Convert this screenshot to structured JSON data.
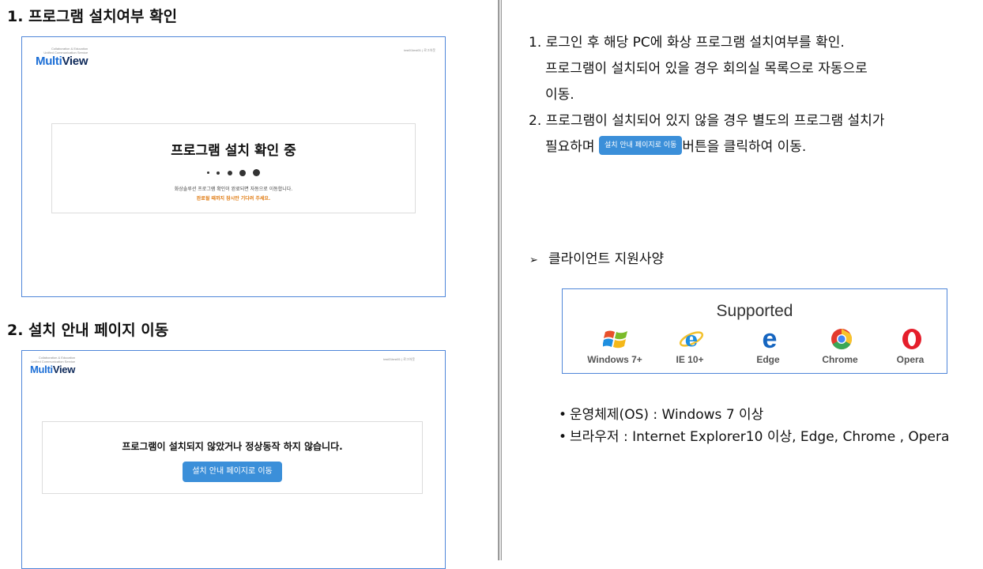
{
  "left": {
    "section1": {
      "title": "1. 프로그램 설치여부 확인",
      "shot": {
        "logo_tagline_1": "Collaboration & Education",
        "logo_tagline_2": "Unified Communication Service",
        "logo_multi": "Multi",
        "logo_view": "View",
        "user_links": "test01test01 | 로그아웃",
        "card_title": "프로그램 설치 확인 중",
        "card_message": "화상솔루션 프로그램 확인이 완료되면 자동으로 이동합니다.",
        "card_wait": "완료될 때까지 잠시만 기다려 주세요."
      }
    },
    "section2": {
      "title": "2. 설치 안내 페이지 이동",
      "shot": {
        "logo_tagline_1": "Collaboration & Education",
        "logo_tagline_2": "Unified Communication Service",
        "logo_multi": "Multi",
        "logo_view": "View",
        "user_links": "test01test01 | 로그아웃",
        "card_message": "프로그램이 설치되지 않았거나 정상동작 하지 않습니다.",
        "button_label": "설치 안내 페이지로 이동"
      }
    }
  },
  "right": {
    "steps": {
      "line1": "1. 로그인 후 해당 PC에 화상 프로그램 설치여부를 확인.",
      "line2": "프로그램이 설치되어 있을 경우 회의실 목록으로 자동으로",
      "line3": "이동.",
      "line4": "2. 프로그램이 설치되어 있지 않을 경우 별도의 프로그램 설치가",
      "line5_before": "필요하며",
      "line5_button": "설치 안내 페이지로 이동",
      "line5_after": "버튼을 클릭하여 이동."
    },
    "client": {
      "arrow": "➢",
      "title": "클라이언트 지원사양"
    },
    "supported": {
      "title": "Supported",
      "browsers": [
        {
          "label": "Windows 7+",
          "icon": "windows-icon"
        },
        {
          "label": "IE 10+",
          "icon": "internet-explorer-icon"
        },
        {
          "label": "Edge",
          "icon": "edge-icon"
        },
        {
          "label": "Chrome",
          "icon": "chrome-icon"
        },
        {
          "label": "Opera",
          "icon": "opera-icon"
        }
      ]
    },
    "bullets": {
      "dot": "•",
      "os": "운영체제(OS) : Windows 7 이상",
      "browser": "브라우저 : Internet Explorer10 이상, Edge, Chrome , Opera"
    }
  },
  "colors": {
    "border_blue": "#4f86d9",
    "button_blue": "#3b8fd9",
    "logo_blue": "#1d6fd6",
    "logo_navy": "#0f2a5a",
    "wait_orange": "#e07b12"
  }
}
